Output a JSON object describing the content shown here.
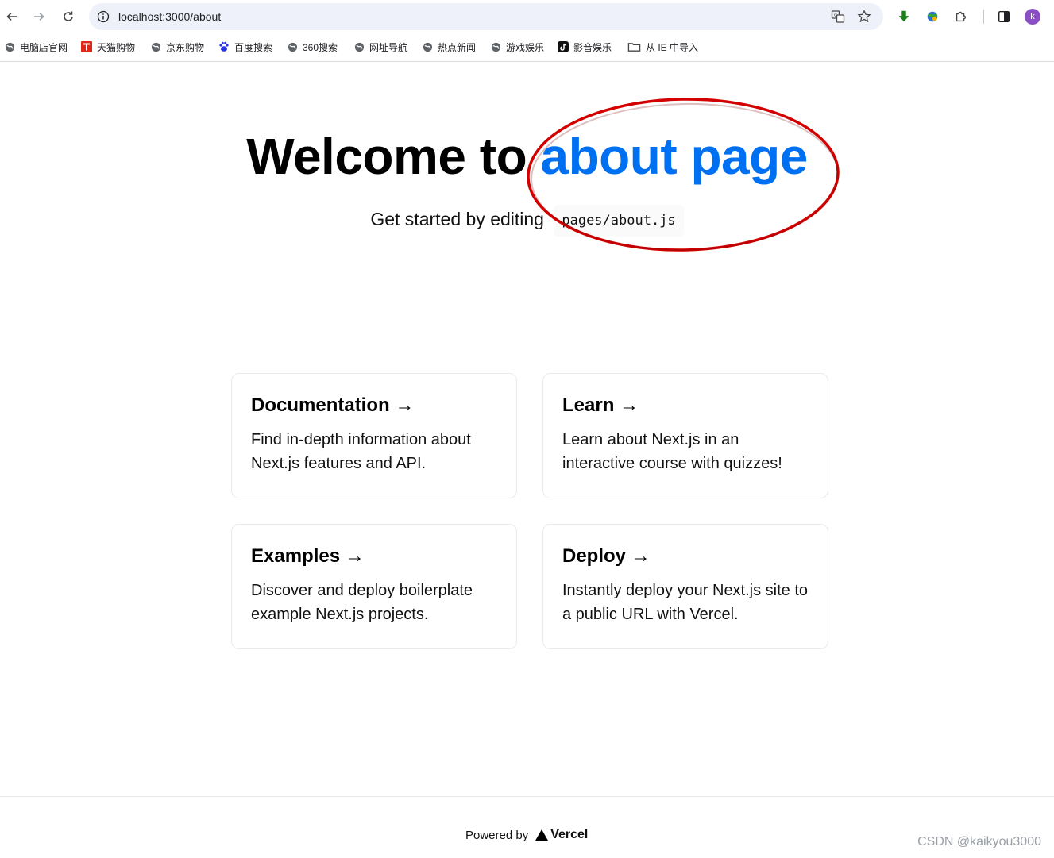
{
  "browser": {
    "url": "localhost:3000/about",
    "avatar_letter": "k",
    "icons": {
      "back": "arrow-left-icon",
      "forward": "arrow-right-icon",
      "reload": "reload-icon",
      "site_info": "info-icon",
      "translate": "translate-icon",
      "bookmark_star": "star-icon",
      "download": "download-icon",
      "extension_globe": "globe-extension-icon",
      "extensions": "puzzle-icon",
      "side_panel": "side-panel-icon"
    }
  },
  "bookmarks": [
    {
      "label": "电脑店官网",
      "icon": "globe-icon"
    },
    {
      "label": "天猫购物",
      "icon": "tmall-icon"
    },
    {
      "label": "京东购物",
      "icon": "globe-icon"
    },
    {
      "label": "百度搜索",
      "icon": "baidu-icon"
    },
    {
      "label": "360搜索",
      "icon": "globe-icon"
    },
    {
      "label": "网址导航",
      "icon": "globe-icon"
    },
    {
      "label": "热点新闻",
      "icon": "globe-icon"
    },
    {
      "label": "游戏娱乐",
      "icon": "globe-icon"
    },
    {
      "label": "影音娱乐",
      "icon": "tiktok-icon"
    },
    {
      "label": "从 IE 中导入",
      "icon": "folder-icon"
    }
  ],
  "hero": {
    "title_prefix": "Welcome to ",
    "title_accent": "about page",
    "subtitle": "Get started by editing",
    "code": "pages/about.js"
  },
  "cards": [
    {
      "title": "Documentation →",
      "text": "Find in-depth information about Next.js features and API."
    },
    {
      "title": "Learn →",
      "text": "Learn about Next.js in an interactive course with quizzes!"
    },
    {
      "title": "Examples →",
      "text": "Discover and deploy boilerplate example Next.js projects."
    },
    {
      "title": "Deploy →",
      "text": "Instantly deploy your Next.js site to a public URL with Vercel."
    }
  ],
  "footer": {
    "powered_by": "Powered by",
    "brand": "Vercel"
  },
  "watermark": "CSDN @kaikyou3000",
  "colors": {
    "accent": "#0070f3",
    "annotation_circle": "#d40000",
    "avatar": "#8a4fc4",
    "download_arrow": "#1a7f1a"
  }
}
